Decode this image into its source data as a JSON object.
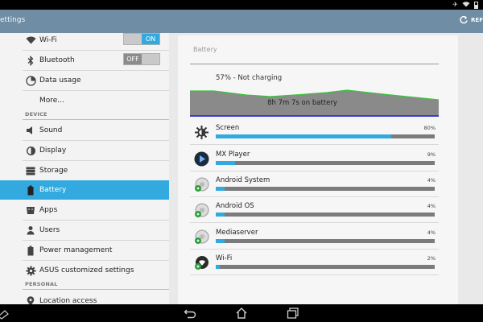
{
  "status_bar": {
    "icons": [
      "airplane-icon",
      "wifi-icon",
      "battery-icon"
    ]
  },
  "action_bar": {
    "title": "ettings",
    "refresh_label": "REF"
  },
  "sidebar": {
    "items": [
      {
        "label": "Wi-Fi",
        "icon": "wifi-icon",
        "toggle": "ON"
      },
      {
        "label": "Bluetooth",
        "icon": "bluetooth-icon",
        "toggle": "OFF"
      },
      {
        "label": "Data usage",
        "icon": "data-usage-icon"
      },
      {
        "label": "More...",
        "icon": ""
      },
      {
        "label": "Sound",
        "icon": "sound-icon"
      },
      {
        "label": "Display",
        "icon": "display-icon"
      },
      {
        "label": "Storage",
        "icon": "storage-icon"
      },
      {
        "label": "Battery",
        "icon": "battery-icon"
      },
      {
        "label": "Apps",
        "icon": "apps-icon"
      },
      {
        "label": "Users",
        "icon": "users-icon"
      },
      {
        "label": "Power management",
        "icon": "power-management-icon"
      },
      {
        "label": "ASUS customized settings",
        "icon": "asus-settings-icon"
      },
      {
        "label": "Location access",
        "icon": "location-icon"
      }
    ],
    "headers": {
      "device": "DEVICE",
      "personal": "PERSONAL"
    },
    "selected": "Battery"
  },
  "battery": {
    "title": "Battery",
    "status": "57% - Not charging",
    "graph_label": "8h 7m 7s on battery",
    "level_fraction": 0.57,
    "usage": [
      {
        "name": "Screen",
        "percent": "80%",
        "value": 80,
        "icon": "screen-brightness-icon"
      },
      {
        "name": "MX Player",
        "percent": "9%",
        "value": 9,
        "icon": "mx-player-icon"
      },
      {
        "name": "Android System",
        "percent": "4%",
        "value": 4,
        "icon": "android-system-icon"
      },
      {
        "name": "Android OS",
        "percent": "4%",
        "value": 4,
        "icon": "android-os-icon"
      },
      {
        "name": "Mediaserver",
        "percent": "4%",
        "value": 4,
        "icon": "mediaserver-icon"
      },
      {
        "name": "Wi-Fi",
        "percent": "2%",
        "value": 2,
        "icon": "wifi-icon"
      }
    ]
  },
  "nav_bar": {
    "buttons": [
      "back-icon",
      "home-icon",
      "recents-icon"
    ]
  },
  "colors": {
    "accent": "#33aadf",
    "action_bar": "#6f8ea6",
    "graph_line": "#39c43a",
    "graph_base": "#3a3ad0"
  }
}
